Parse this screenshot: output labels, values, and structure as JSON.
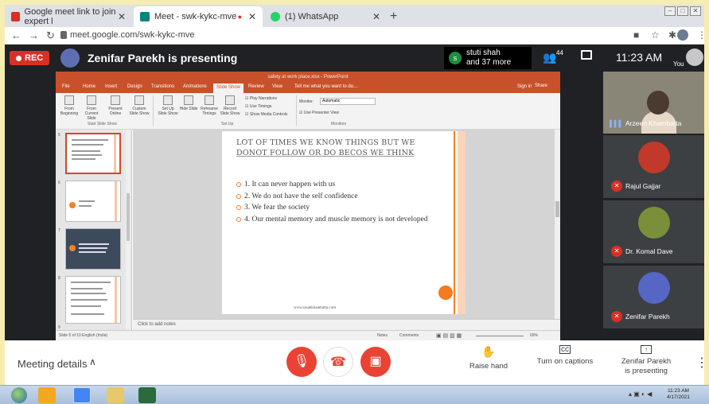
{
  "browser": {
    "tabs": [
      {
        "title": "Google meet link to join expert l",
        "color": "#d93025"
      },
      {
        "title": "Meet - swk-kykc-mve",
        "color": "#00897b"
      },
      {
        "title": "(1) WhatsApp",
        "color": "#25d366"
      }
    ],
    "url": "meet.google.com/swk-kykc-mve"
  },
  "meet_top": {
    "rec_label": "REC",
    "presenting_text": "Zenifar Parekh is presenting",
    "participant_initial": "s",
    "participant_name": "stuti shah",
    "participant_more": "and 37 more",
    "people_count": "44",
    "time": "11:23 AM",
    "you_label": "You"
  },
  "ppt": {
    "title": "safety at work place.xlsx - PowerPoint",
    "tabs": [
      "File",
      "Home",
      "Insert",
      "Design",
      "Transitions",
      "Animations",
      "Slide Show",
      "Review",
      "View"
    ],
    "active_tab": "Slide Show",
    "tell_me": "Tell me what you want to do...",
    "sign_in": "Sign in",
    "share": "Share",
    "ribbon_buttons": [
      "From Beginning",
      "From Current Slide",
      "Present Online",
      "Custom Slide Show",
      "Set Up Slide Show",
      "Hide Slide",
      "Rehearse Timings",
      "Record Slide Show"
    ],
    "ribbon_checks": [
      "Play Narrations",
      "Use Timings",
      "Show Media Controls"
    ],
    "monitor_label": "Monitor:",
    "monitor_value": "Automatic",
    "presenter_view": "Use Presenter View",
    "groups": [
      "Start Slide Show",
      "Set Up",
      "Monitors"
    ],
    "thumb_numbers": [
      "5",
      "6",
      "7",
      "8",
      "9"
    ],
    "slide": {
      "title_line1": "LOT OF TIMES WE KNOW THINGS BUT WE",
      "title_line2": "DONOT FOLLOW OR DO BECOS WE THINK",
      "bullets": [
        "1. It can never happen with us",
        "2. We do not have the self confidence",
        "3. We fear the society",
        "4. Our mental memory and muscle memory is not developed"
      ],
      "footer": "www.rasakkhambatta.com"
    },
    "notes_placeholder": "Click to add notes",
    "status_left": "Slide 5 of 10    English (India)",
    "status_notes": "Notes",
    "status_comments": "Comments",
    "zoom": "69%"
  },
  "participants": [
    {
      "name": "Arzeen Khambatta",
      "speaking": true,
      "avatar_color": "#8a8677"
    },
    {
      "name": "Rajul Gajjar",
      "muted": true,
      "avatar_color": "#c0392b"
    },
    {
      "name": "Dr. Komal Dave",
      "muted": true,
      "avatar_color": "#7a8f3a"
    },
    {
      "name": "Zenifar Parekh",
      "muted": true,
      "avatar_color": "#5566c4"
    }
  ],
  "meet_bottom": {
    "meeting_details": "Meeting details",
    "raise_hand": "Raise hand",
    "captions": "Turn on captions",
    "presenting_line1": "Zenifar Parekh",
    "presenting_line2": "is presenting"
  },
  "taskbar": {
    "time": "11:23 AM",
    "date": "4/17/2021"
  }
}
